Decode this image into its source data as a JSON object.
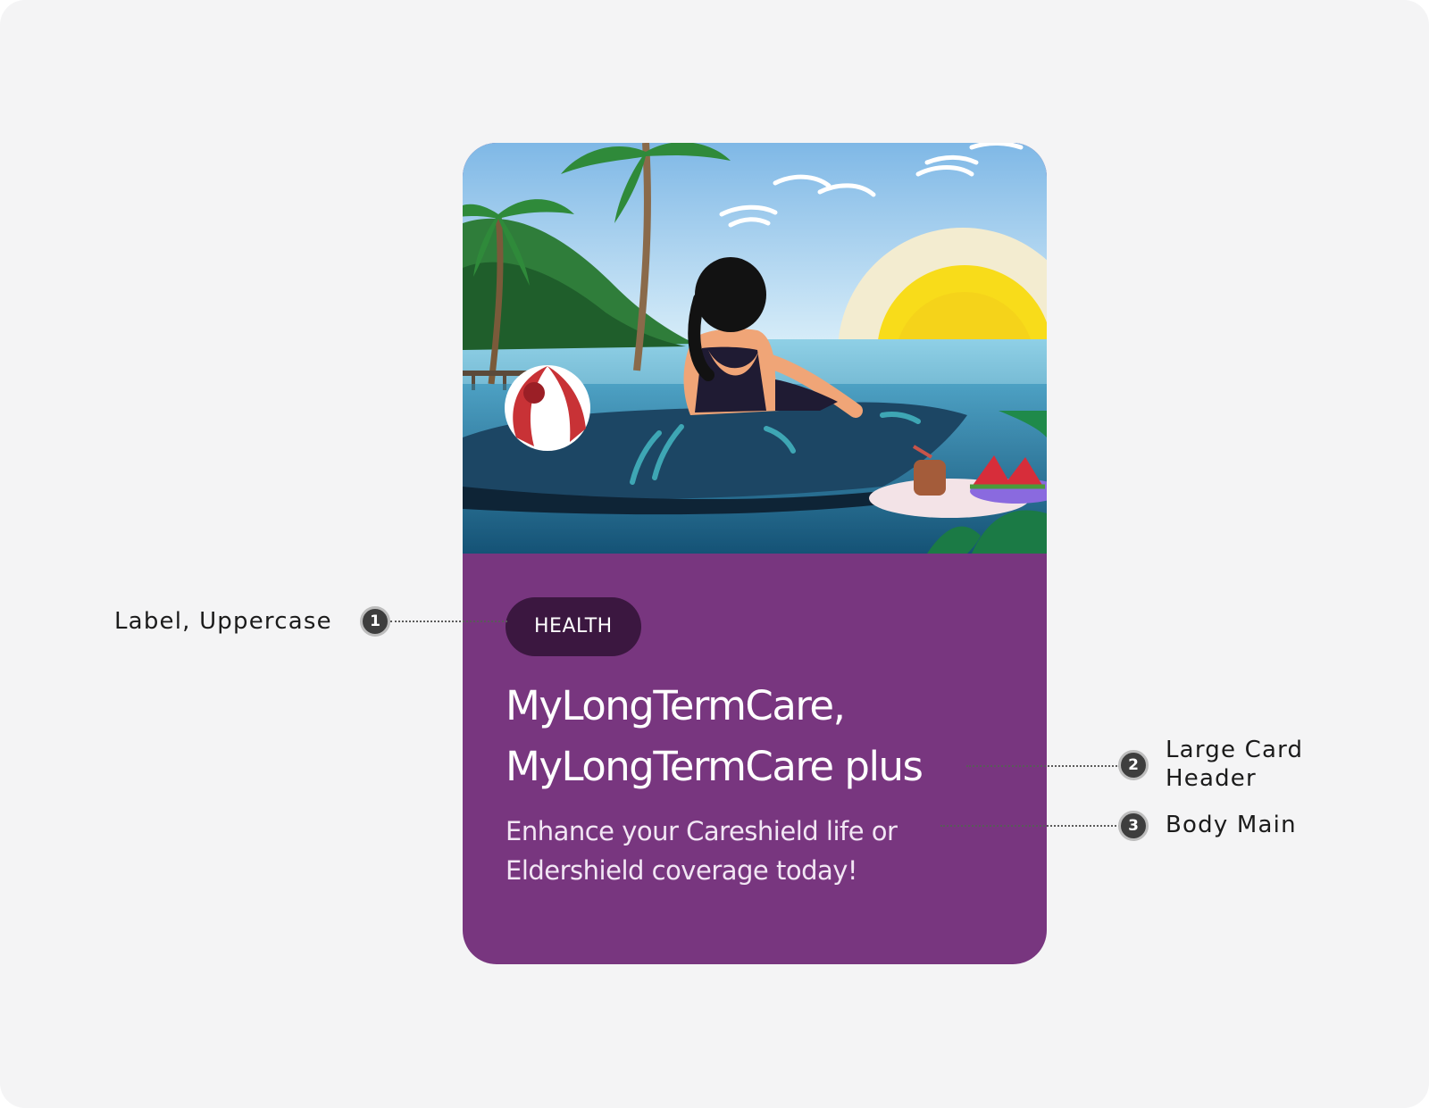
{
  "card": {
    "badge": "HEALTH",
    "title_lines": [
      "MyLongTermCare,",
      "MyLongTermCare plus"
    ],
    "body_lines": [
      "Enhance your Careshield life or",
      "Eldershield coverage today!"
    ],
    "colors": {
      "card_bg": "#78367f",
      "badge_bg": "#3b1740",
      "text": "#ffffff"
    },
    "image": {
      "description_icon": "beach-pool-illustration"
    }
  },
  "annotations": [
    {
      "number": "1",
      "label_lines": [
        "Label, Uppercase"
      ]
    },
    {
      "number": "2",
      "label_lines": [
        "Large Card",
        "Header"
      ]
    },
    {
      "number": "3",
      "label_lines": [
        "Body Main"
      ]
    }
  ]
}
